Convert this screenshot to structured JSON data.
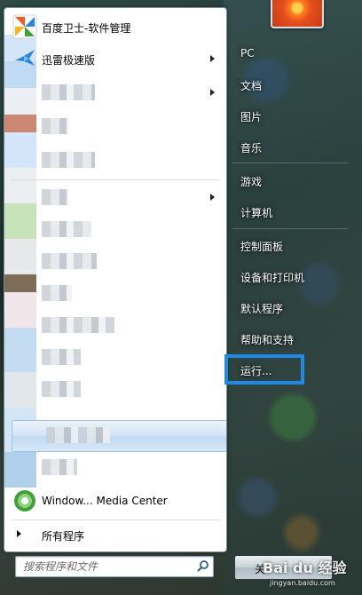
{
  "start_menu": {
    "pinned_programs": [
      {
        "label": "百度卫士-软件管理",
        "has_submenu": false,
        "icon": "baidu-shield-icon",
        "icon_color": "#f05a28"
      },
      {
        "label": "迅雷极速版",
        "has_submenu": true,
        "icon": "thunder-bird-icon",
        "icon_color": "#2b86d9"
      }
    ],
    "bottom_program": {
      "label": "Window... Media Center",
      "icon": "media-center-icon",
      "icon_color": "#3fa13a"
    },
    "all_programs_label": "所有程序",
    "search_placeholder": "搜索程序和文件",
    "right_pane": [
      {
        "label": "PC"
      },
      {
        "label": "文档"
      },
      {
        "label": "图片"
      },
      {
        "label": "音乐"
      },
      {
        "label": "游戏"
      },
      {
        "label": "计算机"
      },
      {
        "label": "控制面板"
      },
      {
        "label": "设备和打印机"
      },
      {
        "label": "默认程序"
      },
      {
        "label": "帮助和支持"
      },
      {
        "label": "运行..."
      }
    ],
    "shutdown_label": "关"
  },
  "watermark": {
    "text": "Bai du 经验",
    "sub": "jingyan.baidu.com"
  },
  "colors": {
    "highlight_border": "#1d8ae6",
    "hover_row": "#c2daf3"
  }
}
